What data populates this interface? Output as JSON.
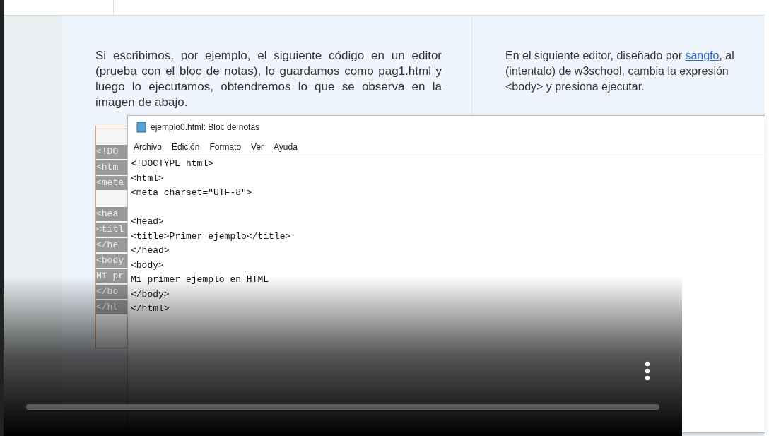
{
  "left_column": {
    "paragraph": "Si escribimos, por ejemplo, el siguiente código en un editor (prueba con el bloc de notas), lo guardamos como pag1.html y luego lo ejecutamos, obtendremos lo que se observa en la imagen de abajo.",
    "code_fragments": [
      {
        "kind": "code",
        "text": "<!DO"
      },
      {
        "kind": "code",
        "text": "<htm"
      },
      {
        "kind": "code",
        "text": "<meta"
      },
      {
        "kind": "blank"
      },
      {
        "kind": "code",
        "text": "<hea"
      },
      {
        "kind": "code",
        "text": "<titl"
      },
      {
        "kind": "code",
        "text": "</he"
      },
      {
        "kind": "code",
        "text": "<body"
      },
      {
        "kind": "code",
        "text": "Mi pr"
      },
      {
        "kind": "code",
        "text": "</bo"
      },
      {
        "kind": "code",
        "text": "</ht"
      }
    ]
  },
  "right_column": {
    "lines": [
      {
        "before": "En el siguiente editor, diseñado por ",
        "link": "sangfo",
        "after": ", al"
      },
      {
        "before": "(intentalo) de w3school, cambia la expresión"
      },
      {
        "before": "<body> y presiona ejecutar."
      }
    ]
  },
  "notepad": {
    "title": "ejemplo0.html: Bloc de notas",
    "menu": [
      "Archivo",
      "Edición",
      "Formato",
      "Ver",
      "Ayuda"
    ],
    "lines": [
      {
        "kind": "code",
        "text": "<!DOCTYPE html>"
      },
      {
        "kind": "code",
        "text": "<html>"
      },
      {
        "kind": "code",
        "text": "<meta charset=\"UTF-8\">"
      },
      {
        "kind": "blank"
      },
      {
        "kind": "code",
        "text": "<head>"
      },
      {
        "kind": "code",
        "text": "<title>Primer ejemplo</title>"
      },
      {
        "kind": "code",
        "text": "</head>"
      },
      {
        "kind": "code",
        "text": "<body>"
      },
      {
        "kind": "code",
        "text": "Mi primer ejemplo en HTML"
      },
      {
        "kind": "code",
        "text": "</body>"
      },
      {
        "kind": "code",
        "text": "</html>"
      }
    ]
  }
}
